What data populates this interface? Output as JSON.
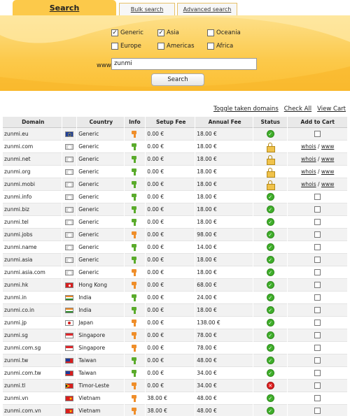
{
  "tabs": [
    {
      "label": "Search"
    },
    {
      "label": "Bulk search"
    },
    {
      "label": "Advanced search"
    }
  ],
  "regions": [
    {
      "label": "Generic",
      "checked": true
    },
    {
      "label": "Asia",
      "checked": true
    },
    {
      "label": "Oceania",
      "checked": false
    },
    {
      "label": "Europe",
      "checked": false
    },
    {
      "label": "Americas",
      "checked": false
    },
    {
      "label": "Africa",
      "checked": false
    }
  ],
  "search": {
    "prefix": "www.",
    "value": "zunmi",
    "button": "Search"
  },
  "links": {
    "toggle": "Toggle taken domains",
    "check_all": "Check All",
    "view_cart": "View Cart"
  },
  "columns": [
    "Domain",
    "Country",
    "Info",
    "Setup Fee",
    "Annual Fee",
    "Status",
    "Add to Cart"
  ],
  "taken_links": {
    "whois": "whois",
    "sep": "/",
    "www": "www"
  },
  "colors": {
    "panel": "#fcc94a",
    "ok": "#3fae2a",
    "taken": "#f0c24a",
    "error": "#e02020"
  },
  "rows": [
    {
      "domain": "zunmi.eu",
      "flag": "eu",
      "country": "Generic",
      "info": "orange",
      "setup": "0.00 €",
      "annual": "18.00 €",
      "status": "available"
    },
    {
      "domain": "zunmi.com",
      "flag": "generic",
      "country": "Generic",
      "info": "green",
      "setup": "0.00 €",
      "annual": "18.00 €",
      "status": "taken"
    },
    {
      "domain": "zunmi.net",
      "flag": "generic",
      "country": "Generic",
      "info": "green",
      "setup": "0.00 €",
      "annual": "18.00 €",
      "status": "taken"
    },
    {
      "domain": "zunmi.org",
      "flag": "generic",
      "country": "Generic",
      "info": "green",
      "setup": "0.00 €",
      "annual": "18.00 €",
      "status": "taken"
    },
    {
      "domain": "zunmi.mobi",
      "flag": "generic",
      "country": "Generic",
      "info": "green",
      "setup": "0.00 €",
      "annual": "18.00 €",
      "status": "taken"
    },
    {
      "domain": "zunmi.info",
      "flag": "generic",
      "country": "Generic",
      "info": "green",
      "setup": "0.00 €",
      "annual": "18.00 €",
      "status": "available"
    },
    {
      "domain": "zunmi.biz",
      "flag": "generic",
      "country": "Generic",
      "info": "green",
      "setup": "0.00 €",
      "annual": "18.00 €",
      "status": "available"
    },
    {
      "domain": "zunmi.tel",
      "flag": "generic",
      "country": "Generic",
      "info": "green",
      "setup": "0.00 €",
      "annual": "18.00 €",
      "status": "available"
    },
    {
      "domain": "zunmi.jobs",
      "flag": "generic",
      "country": "Generic",
      "info": "orange",
      "setup": "0.00 €",
      "annual": "98.00 €",
      "status": "available"
    },
    {
      "domain": "zunmi.name",
      "flag": "generic",
      "country": "Generic",
      "info": "green",
      "setup": "0.00 €",
      "annual": "14.00 €",
      "status": "available"
    },
    {
      "domain": "zunmi.asia",
      "flag": "generic",
      "country": "Generic",
      "info": "green",
      "setup": "0.00 €",
      "annual": "18.00 €",
      "status": "available"
    },
    {
      "domain": "zunmi.asia.com",
      "flag": "generic",
      "country": "Generic",
      "info": "orange",
      "setup": "0.00 €",
      "annual": "18.00 €",
      "status": "available"
    },
    {
      "domain": "zunmi.hk",
      "flag": "hk",
      "country": "Hong Kong",
      "info": "orange",
      "setup": "0.00 €",
      "annual": "68.00 €",
      "status": "available"
    },
    {
      "domain": "zunmi.in",
      "flag": "in",
      "country": "India",
      "info": "green",
      "setup": "0.00 €",
      "annual": "24.00 €",
      "status": "available"
    },
    {
      "domain": "zunmi.co.in",
      "flag": "in",
      "country": "India",
      "info": "green",
      "setup": "0.00 €",
      "annual": "18.00 €",
      "status": "available"
    },
    {
      "domain": "zunmi.jp",
      "flag": "jp",
      "country": "Japan",
      "info": "orange",
      "setup": "0.00 €",
      "annual": "138.00 €",
      "status": "available"
    },
    {
      "domain": "zunmi.sg",
      "flag": "sg",
      "country": "Singapore",
      "info": "orange",
      "setup": "0.00 €",
      "annual": "78.00 €",
      "status": "available"
    },
    {
      "domain": "zunmi.com.sg",
      "flag": "sg",
      "country": "Singapore",
      "info": "orange",
      "setup": "0.00 €",
      "annual": "78.00 €",
      "status": "available"
    },
    {
      "domain": "zunmi.tw",
      "flag": "tw",
      "country": "Taiwan",
      "info": "green",
      "setup": "0.00 €",
      "annual": "48.00 €",
      "status": "available"
    },
    {
      "domain": "zunmi.com.tw",
      "flag": "tw",
      "country": "Taiwan",
      "info": "green",
      "setup": "0.00 €",
      "annual": "34.00 €",
      "status": "available"
    },
    {
      "domain": "zunmi.tl",
      "flag": "tl",
      "country": "Timor-Leste",
      "info": "orange",
      "setup": "0.00 €",
      "annual": "34.00 €",
      "status": "unavailable"
    },
    {
      "domain": "zunmi.vn",
      "flag": "vn",
      "country": "Vietnam",
      "info": "orange",
      "setup": "38.00 €",
      "annual": "48.00 €",
      "status": "available"
    },
    {
      "domain": "zunmi.com.vn",
      "flag": "vn",
      "country": "Vietnam",
      "info": "orange",
      "setup": "38.00 €",
      "annual": "48.00 €",
      "status": "available"
    }
  ]
}
